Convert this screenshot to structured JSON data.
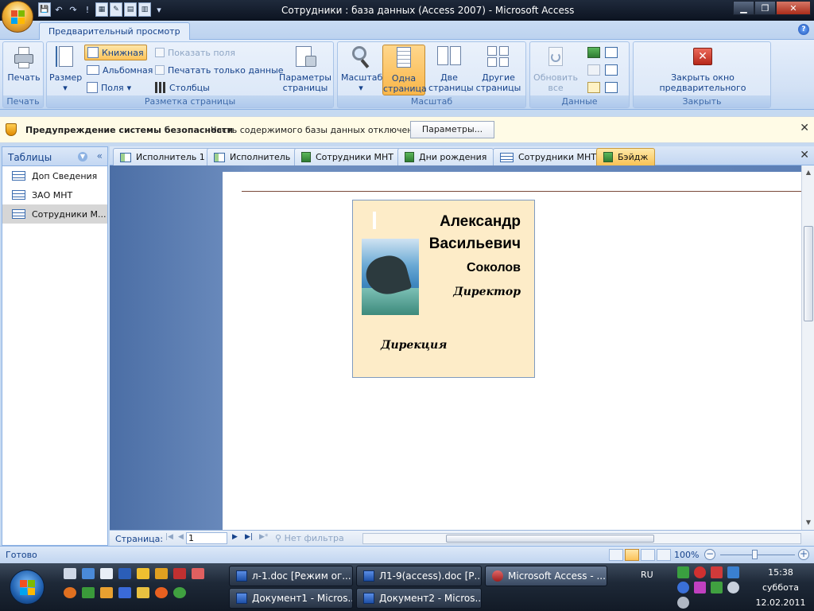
{
  "window": {
    "title": "Сотрудники : база данных (Access 2007) - Microsoft Access",
    "minimize": "▁",
    "maximize": "❐",
    "close": "✕"
  },
  "qat": [
    "💾",
    "↶",
    "↷",
    "!"
  ],
  "ribbon": {
    "active_tab": "Предварительный просмотр",
    "groups": {
      "print": {
        "label": "Печать",
        "print_button": "Печать"
      },
      "layout": {
        "label": "Разметка страницы",
        "size_button": "Размер",
        "portrait": "Книжная",
        "landscape": "Альбомная",
        "margins": "Поля",
        "show_margins": "Показать поля",
        "print_data_only": "Печатать только данные",
        "columns": "Столбцы",
        "page_setup_1": "Параметры",
        "page_setup_2": "страницы"
      },
      "zoom": {
        "label": "Масштаб",
        "zoom_button": "Масштаб",
        "one_page_1": "Одна",
        "one_page_2": "страница",
        "two_pages_1": "Две",
        "two_pages_2": "страницы",
        "more_pages_1": "Другие",
        "more_pages_2": "страницы"
      },
      "data": {
        "label": "Данные",
        "refresh_1": "Обновить",
        "refresh_2": "все"
      },
      "close": {
        "label": "Закрыть",
        "close_preview_1": "Закрыть окно",
        "close_preview_2": "предварительного просмотра"
      }
    }
  },
  "security_bar": {
    "title": "Предупреждение системы безопасности",
    "message": "Часть содержимого базы данных отключено",
    "options_button": "Параметры...",
    "close": "✕"
  },
  "nav_pane": {
    "title": "Таблицы",
    "collapse": "«",
    "items": [
      {
        "label": "Доп Сведения"
      },
      {
        "label": "ЗАО МНТ"
      },
      {
        "label": "Сотрудники М..."
      }
    ]
  },
  "doc_tabs": [
    {
      "label": "Исполнитель 1"
    },
    {
      "label": "Исполнитель"
    },
    {
      "label": "Сотрудники МНТ"
    },
    {
      "label": "Дни рождения"
    },
    {
      "label": "Сотрудники МНТ"
    },
    {
      "label": "Бэйдж"
    }
  ],
  "doc_tabs_close": "✕",
  "badge": {
    "first_name": "Александр",
    "patronymic": "Васильевич",
    "last_name": "Соколов",
    "position": "Директор",
    "department": "Дирекция"
  },
  "record_nav": {
    "label": "Страница:",
    "page": "1",
    "filter": "Нет фильтра"
  },
  "status": {
    "text": "Готово",
    "zoom": "100%"
  },
  "taskbar": {
    "buttons": [
      {
        "label": "л-1.doc [Режим ог..."
      },
      {
        "label": "Л1-9(access).doc [Р..."
      },
      {
        "label": "Microsoft Access - ..."
      },
      {
        "label": "Документ1 - Micros..."
      },
      {
        "label": "Документ2 - Micros..."
      }
    ],
    "lang": "RU",
    "time": "15:38",
    "day": "суббота",
    "date": "12.02.2011"
  }
}
